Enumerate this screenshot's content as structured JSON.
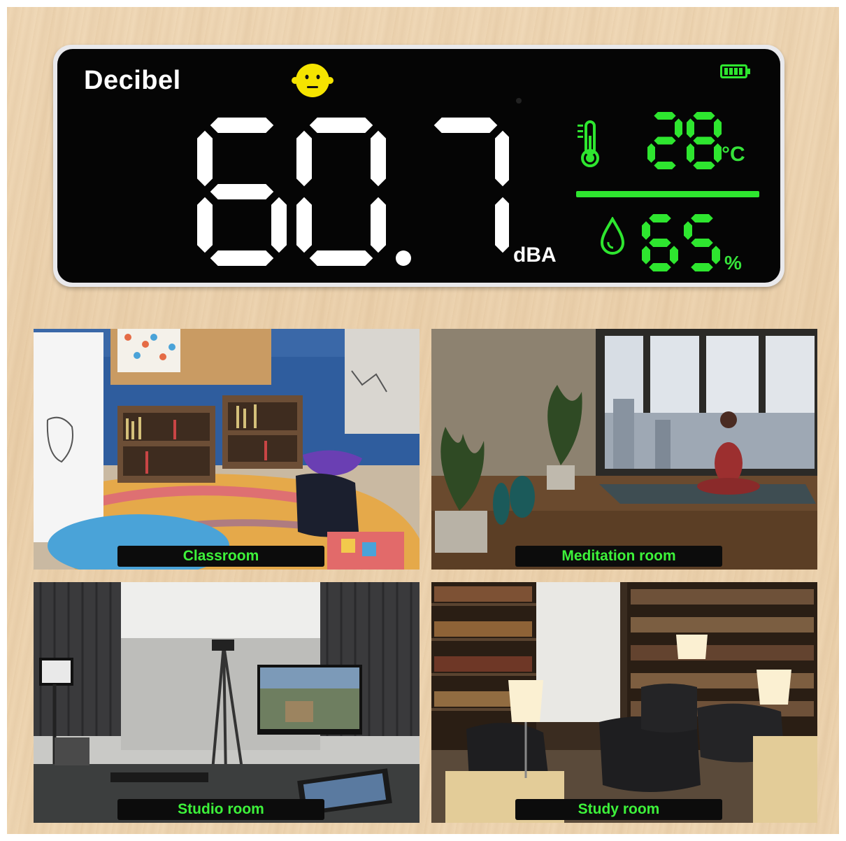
{
  "device": {
    "title": "Decibel",
    "decibel_value": "60.7",
    "decibel_unit": "dBA",
    "temperature_value": "28",
    "temperature_unit": "°C",
    "humidity_value": "65",
    "humidity_unit": "%",
    "face_icon": "neutral-face-icon",
    "battery_icon": "battery-full-icon",
    "accent_color": "#2ee62f",
    "face_color": "#f5e400"
  },
  "scenes": [
    {
      "caption": "Classroom"
    },
    {
      "caption": "Meditation room"
    },
    {
      "caption": "Studio room"
    },
    {
      "caption": "Study room"
    }
  ]
}
